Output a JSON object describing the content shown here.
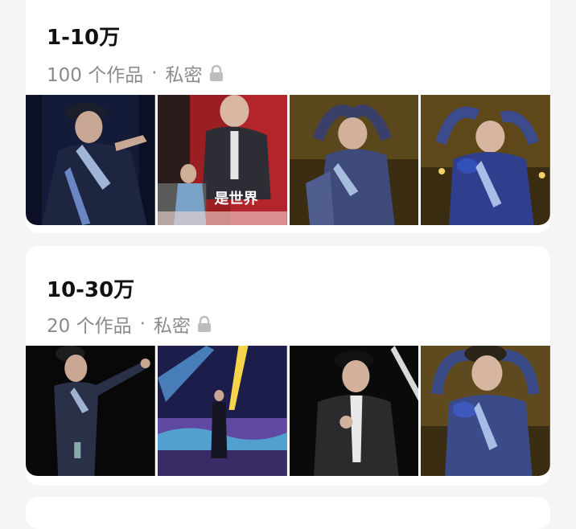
{
  "albums": [
    {
      "title": "1-10万",
      "count": "100 个作品",
      "separator": "·",
      "privacy": "私密",
      "privacy_icon": "lock-icon"
    },
    {
      "title": "10-30万",
      "count": "20 个作品",
      "separator": "·",
      "privacy": "私密",
      "privacy_icon": "lock-icon"
    }
  ],
  "colors": {
    "card_bg": "#ffffff",
    "page_bg": "#f5f5f5",
    "title": "#111111",
    "meta": "#8a8a8a"
  }
}
